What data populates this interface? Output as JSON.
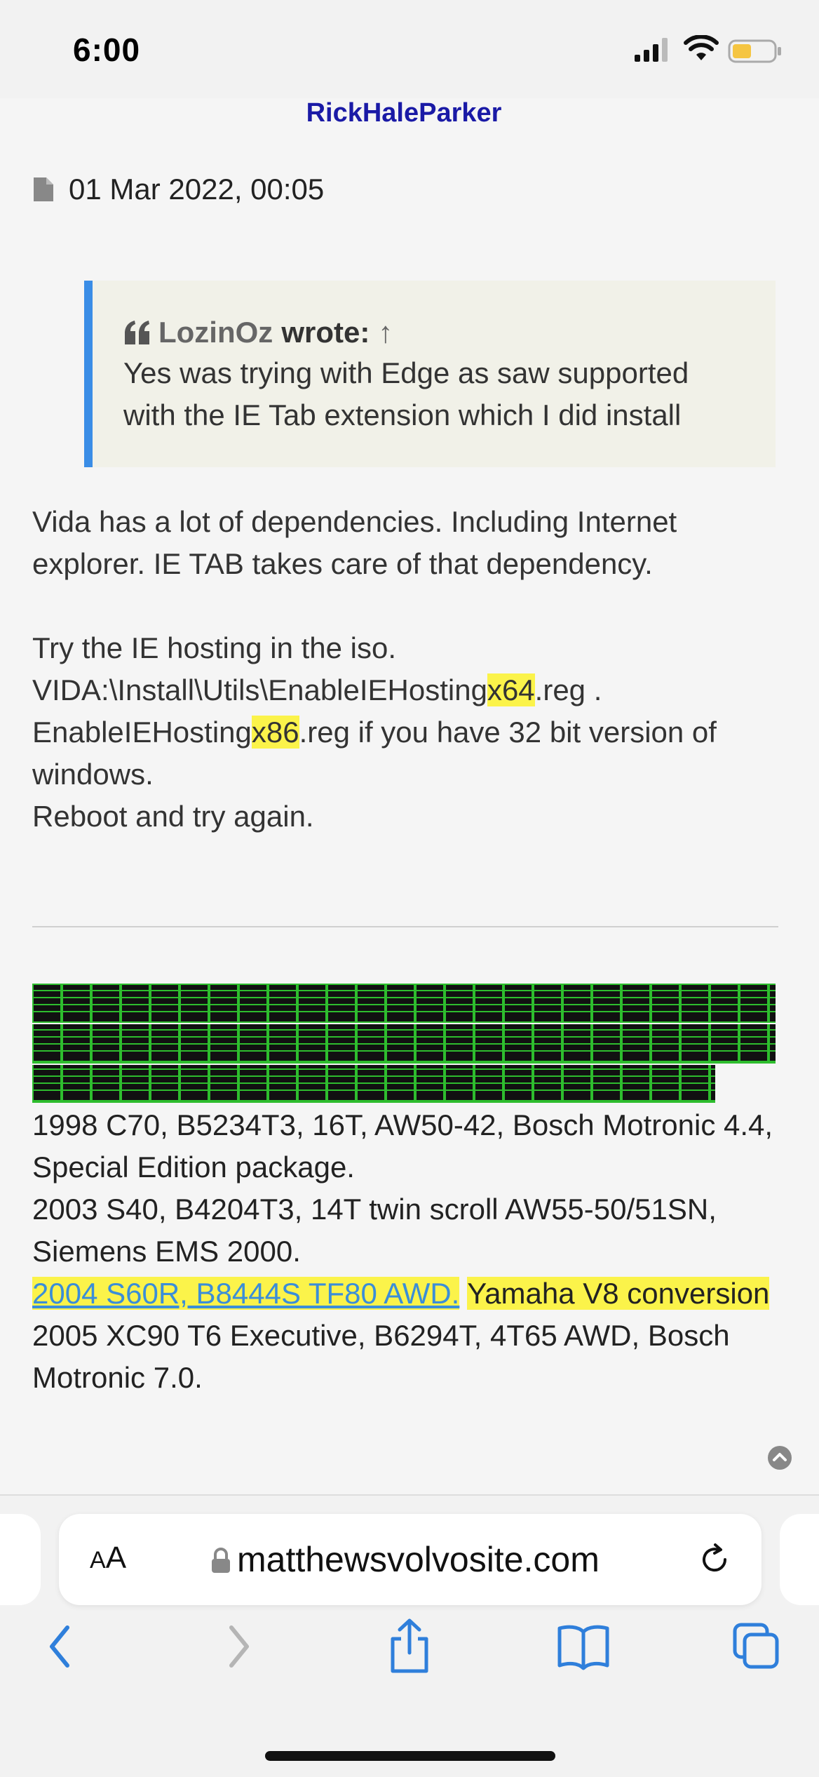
{
  "status_bar": {
    "time": "6:00",
    "battery_color": "#f5c542"
  },
  "post": {
    "author": "RickHaleParker",
    "date": "01 Mar 2022, 00:05",
    "quote": {
      "author": "LozinOz",
      "wrote": "wrote:",
      "arrow": "↑",
      "text": "Yes was trying with Edge as saw supported with the IE Tab extension which I did install"
    },
    "para1": "Vida has a lot of dependencies. Including Internet explorer. IE TAB takes care of that dependency.",
    "para2": {
      "line1": "Try the IE hosting in the iso.",
      "l2_a": "VIDA:\\Install\\Utils\\EnableIEHosting",
      "l2_hl": "x64",
      "l2_b": ".reg .",
      "l3_a": "EnableIEHosting",
      "l3_hl": "x86",
      "l3_b": ".reg if you have 32 bit version of windows."
    },
    "para3": "Reboot and try again.",
    "signature": {
      "banner_color": "#00cc00",
      "line1": "1998 C70, B5234T3, 16T, AW50-42, Bosch Motronic 4.4, Special Edition package.",
      "line2": "2003 S40, B4204T3, 14T twin scroll AW55-50/51SN, Siemens EMS 2000.",
      "link": "2004 S60R, B8444S TF80 AWD.",
      "yellow": "Yamaha V8 conversion",
      "line4": "2005 XC90 T6 Executive, B6294T, 4T65 AWD, Bosch Motronic 7.0."
    }
  },
  "safari": {
    "aa_small": "A",
    "aa_large": "A",
    "url": "matthewsvolvosite.com",
    "accent_color": "#2f7fdb"
  },
  "icons": [
    "signal-icon",
    "wifi-icon",
    "battery-icon",
    "doc-icon",
    "quote-icon",
    "scroll-top-icon",
    "lock-icon",
    "reload-icon",
    "back-icon",
    "forward-icon",
    "share-icon",
    "bookmarks-icon",
    "tabs-icon"
  ]
}
